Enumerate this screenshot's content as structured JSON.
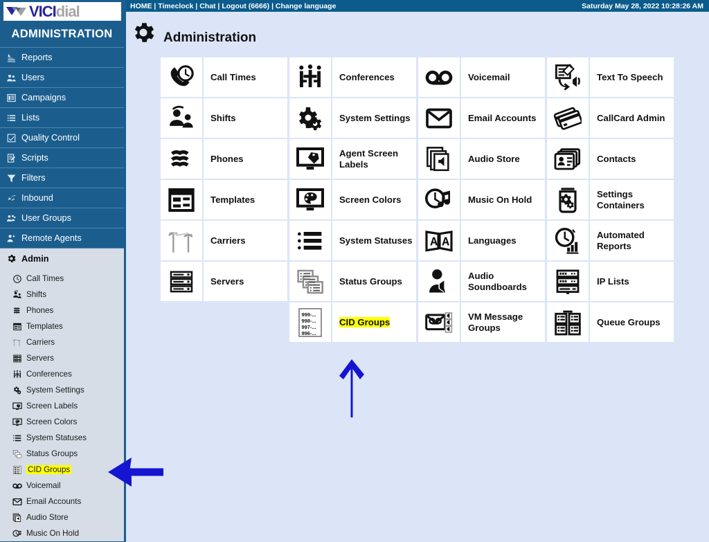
{
  "brand": {
    "vici": "VICI",
    "dial": "dial",
    "admin_title": "ADMINISTRATION"
  },
  "topbar": {
    "links": "HOME | Timeclock | Chat | Logout (6666) | Change language",
    "datetime": "Saturday May 28, 2022 10:28:26 AM"
  },
  "page": {
    "title": "Administration",
    "icon": "gear-icon"
  },
  "colors": {
    "sidebar_bg": "#1b5e8e",
    "topbar_bg": "#0b5c8c",
    "main_bg": "#dbe5f7",
    "tile_bg": "#ffffff",
    "highlight": "#ffff00",
    "annotation": "#1414d2",
    "active_item_bg": "#d6dde6"
  },
  "sidebar": {
    "items": [
      {
        "label": "Reports",
        "icon": "report-icon",
        "active": false
      },
      {
        "label": "Users",
        "icon": "users-icon",
        "active": false
      },
      {
        "label": "Campaigns",
        "icon": "campaigns-icon",
        "active": false
      },
      {
        "label": "Lists",
        "icon": "lists-icon",
        "active": false
      },
      {
        "label": "Quality Control",
        "icon": "checkbox-icon",
        "active": false
      },
      {
        "label": "Scripts",
        "icon": "script-icon",
        "active": false
      },
      {
        "label": "Filters",
        "icon": "funnel-icon",
        "active": false
      },
      {
        "label": "Inbound",
        "icon": "inbound-arrow-icon",
        "active": false
      },
      {
        "label": "User Groups",
        "icon": "user-groups-icon",
        "active": false
      },
      {
        "label": "Remote Agents",
        "icon": "remote-agent-icon",
        "active": false
      },
      {
        "label": "Admin",
        "icon": "gear-icon",
        "active": true
      }
    ],
    "submenu": [
      {
        "label": "Call Times",
        "icon": "clock-icon",
        "highlighted": false
      },
      {
        "label": "Shifts",
        "icon": "shifts-icon",
        "highlighted": false
      },
      {
        "label": "Phones",
        "icon": "phones-icon",
        "highlighted": false
      },
      {
        "label": "Templates",
        "icon": "template-icon",
        "highlighted": false
      },
      {
        "label": "Carriers",
        "icon": "carrier-icon",
        "highlighted": false
      },
      {
        "label": "Servers",
        "icon": "servers-icon",
        "highlighted": false
      },
      {
        "label": "Conferences",
        "icon": "conference-icon",
        "highlighted": false
      },
      {
        "label": "System Settings",
        "icon": "gears-icon",
        "highlighted": false
      },
      {
        "label": "Screen Labels",
        "icon": "screen-label-icon",
        "highlighted": false
      },
      {
        "label": "Screen Colors",
        "icon": "screen-color-icon",
        "highlighted": false
      },
      {
        "label": "System Statuses",
        "icon": "list-status-icon",
        "highlighted": false
      },
      {
        "label": "Status Groups",
        "icon": "status-group-icon",
        "highlighted": false
      },
      {
        "label": "CID Groups",
        "icon": "cid-group-icon",
        "highlighted": true
      },
      {
        "label": "Voicemail",
        "icon": "voicemail-icon",
        "highlighted": false
      },
      {
        "label": "Email Accounts",
        "icon": "envelope-icon",
        "highlighted": false
      },
      {
        "label": "Audio Store",
        "icon": "audio-store-icon",
        "highlighted": false
      },
      {
        "label": "Music On Hold",
        "icon": "music-hold-icon",
        "highlighted": false
      }
    ]
  },
  "grid": {
    "tiles": [
      {
        "label": "Call Times",
        "icon": "call-times-icon",
        "highlighted": false
      },
      {
        "label": "Conferences",
        "icon": "conferences-icon",
        "highlighted": false
      },
      {
        "label": "Voicemail",
        "icon": "voicemail-icon",
        "highlighted": false
      },
      {
        "label": "Text To Speech",
        "icon": "text-to-speech-icon",
        "highlighted": false
      },
      {
        "label": "Shifts",
        "icon": "shifts-icon",
        "highlighted": false
      },
      {
        "label": "System Settings",
        "icon": "system-settings-icon",
        "highlighted": false
      },
      {
        "label": "Email Accounts",
        "icon": "envelope-icon",
        "highlighted": false
      },
      {
        "label": "CallCard Admin",
        "icon": "callcard-icon",
        "highlighted": false
      },
      {
        "label": "Phones",
        "icon": "phones-icon",
        "highlighted": false
      },
      {
        "label": "Agent Screen Labels",
        "icon": "agent-screen-label-icon",
        "highlighted": false
      },
      {
        "label": "Audio Store",
        "icon": "audio-store-icon",
        "highlighted": false
      },
      {
        "label": "Contacts",
        "icon": "contacts-icon",
        "highlighted": false
      },
      {
        "label": "Templates",
        "icon": "templates-icon",
        "highlighted": false
      },
      {
        "label": "Screen Colors",
        "icon": "screen-colors-icon",
        "highlighted": false
      },
      {
        "label": "Music On Hold",
        "icon": "music-on-hold-icon",
        "highlighted": false
      },
      {
        "label": "Settings Containers",
        "icon": "settings-container-icon",
        "highlighted": false
      },
      {
        "label": "Carriers",
        "icon": "carriers-icon",
        "highlighted": false
      },
      {
        "label": "System Statuses",
        "icon": "system-statuses-icon",
        "highlighted": false
      },
      {
        "label": "Languages",
        "icon": "languages-icon",
        "highlighted": false
      },
      {
        "label": "Automated Reports",
        "icon": "automated-reports-icon",
        "highlighted": false
      },
      {
        "label": "Servers",
        "icon": "servers-icon",
        "highlighted": false
      },
      {
        "label": "Status Groups",
        "icon": "status-groups-icon",
        "highlighted": false
      },
      {
        "label": "Audio Soundboards",
        "icon": "audio-soundboards-icon",
        "highlighted": false
      },
      {
        "label": "IP Lists",
        "icon": "ip-lists-icon",
        "highlighted": false
      },
      {
        "label": "",
        "icon": "",
        "highlighted": false
      },
      {
        "label": "CID Groups",
        "icon": "cid-groups-icon",
        "highlighted": true
      },
      {
        "label": "VM Message Groups",
        "icon": "vm-message-groups-icon",
        "highlighted": false
      },
      {
        "label": "Queue Groups",
        "icon": "queue-groups-icon",
        "highlighted": false
      }
    ],
    "cid_icon_lines": [
      "999-...",
      "998-...",
      "997-...",
      "996-..."
    ]
  },
  "annotations": [
    {
      "name": "up-arrow-to-cid-groups-tile",
      "shape": "arrow-up"
    },
    {
      "name": "left-arrow-to-cid-groups-menu",
      "shape": "arrow-left"
    }
  ]
}
